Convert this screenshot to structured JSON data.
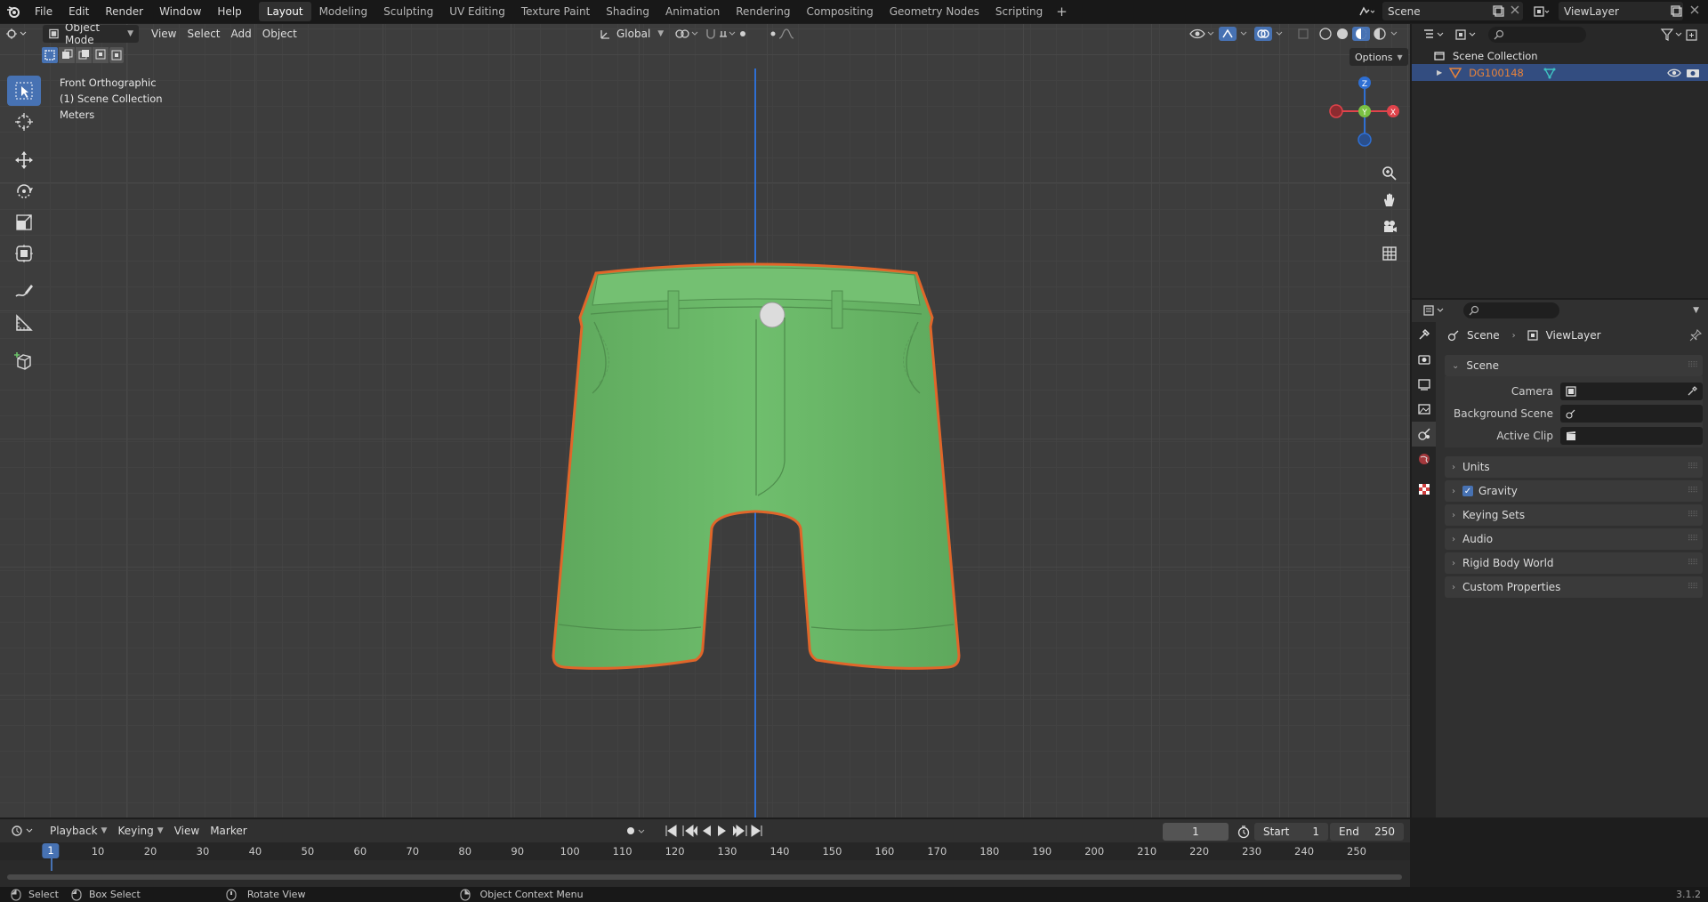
{
  "topbar": {
    "menus": [
      "File",
      "Edit",
      "Render",
      "Window",
      "Help"
    ],
    "workspaces": [
      "Layout",
      "Modeling",
      "Sculpting",
      "UV Editing",
      "Texture Paint",
      "Shading",
      "Animation",
      "Rendering",
      "Compositing",
      "Geometry Nodes",
      "Scripting"
    ],
    "active_workspace": "Layout",
    "add_workspace": "+",
    "scene_name": "Scene",
    "view_layer_name": "ViewLayer"
  },
  "viewport": {
    "mode": "Object Mode",
    "menus": [
      "View",
      "Select",
      "Add",
      "Object"
    ],
    "transform_orientation": "Global",
    "options_label": "Options",
    "overlay_lines": [
      "Front Orthographic",
      "(1) Scene Collection",
      "Meters"
    ],
    "gizmo_axes": {
      "z": "Z",
      "y": "Y",
      "x": "X"
    },
    "model_color": "#6cb86a",
    "outline_color": "#e0662a",
    "axis_color": "#2e6fd3"
  },
  "outliner": {
    "root": "Scene Collection",
    "object_name": "DG100148",
    "object_color": "#e8833a"
  },
  "properties": {
    "breadcrumb": [
      "Scene",
      "ViewLayer"
    ],
    "scene_panel": "Scene",
    "rows": [
      {
        "label": "Camera"
      },
      {
        "label": "Background Scene"
      },
      {
        "label": "Active Clip"
      }
    ],
    "panels": [
      "Units",
      "Gravity",
      "Keying Sets",
      "Audio",
      "Rigid Body World",
      "Custom Properties"
    ],
    "gravity_checked": true
  },
  "timeline": {
    "menus": [
      "Playback",
      "Keying",
      "View",
      "Marker"
    ],
    "current_frame": "1",
    "start_label": "Start",
    "start": "1",
    "end_label": "End",
    "end": "250",
    "ticks": [
      "1",
      "10",
      "20",
      "30",
      "40",
      "50",
      "60",
      "70",
      "80",
      "90",
      "100",
      "110",
      "120",
      "130",
      "140",
      "150",
      "160",
      "170",
      "180",
      "190",
      "200",
      "210",
      "220",
      "230",
      "240",
      "250"
    ]
  },
  "statusbar": {
    "items": [
      "Select",
      "Box Select",
      "Rotate View",
      "Object Context Menu"
    ],
    "version": "3.1.2"
  }
}
